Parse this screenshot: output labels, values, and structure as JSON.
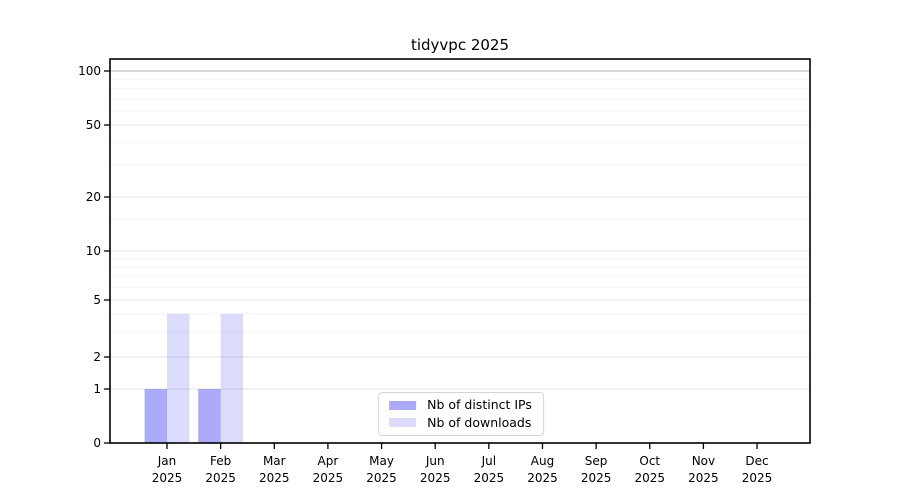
{
  "chart_data": {
    "type": "bar",
    "title": "tidyvpc 2025",
    "categories": [
      "Jan 2025",
      "Feb 2025",
      "Mar 2025",
      "Apr 2025",
      "May 2025",
      "Jun 2025",
      "Jul 2025",
      "Aug 2025",
      "Sep 2025",
      "Oct 2025",
      "Nov 2025",
      "Dec 2025"
    ],
    "series": [
      {
        "name": "Nb of distinct IPs",
        "color": "#aaaaf8",
        "fill": "rgba(34,34,238,0.38)",
        "values": [
          1,
          1,
          0,
          0,
          0,
          0,
          0,
          0,
          0,
          0,
          0,
          0
        ]
      },
      {
        "name": "Nb of downloads",
        "color": "#dcdcfa",
        "fill": "rgba(34,34,238,0.16)",
        "values": [
          4,
          4,
          0,
          0,
          0,
          0,
          0,
          0,
          0,
          0,
          0,
          0
        ]
      }
    ],
    "yticks": [
      0,
      1,
      2,
      5,
      10,
      20,
      50,
      100
    ],
    "minor_yticks": [
      3,
      4,
      6,
      7,
      8,
      9,
      15,
      30,
      40,
      60,
      70,
      80,
      90
    ],
    "ylim": [
      0,
      100
    ],
    "yscale": "log-like",
    "grid": true,
    "legend_position": "lower center",
    "colors": {
      "axis": "#000000",
      "grid_major": "#e6e6e6",
      "grid_minor": "#f4f4f4",
      "grid_top": "#b6b6b6"
    }
  }
}
